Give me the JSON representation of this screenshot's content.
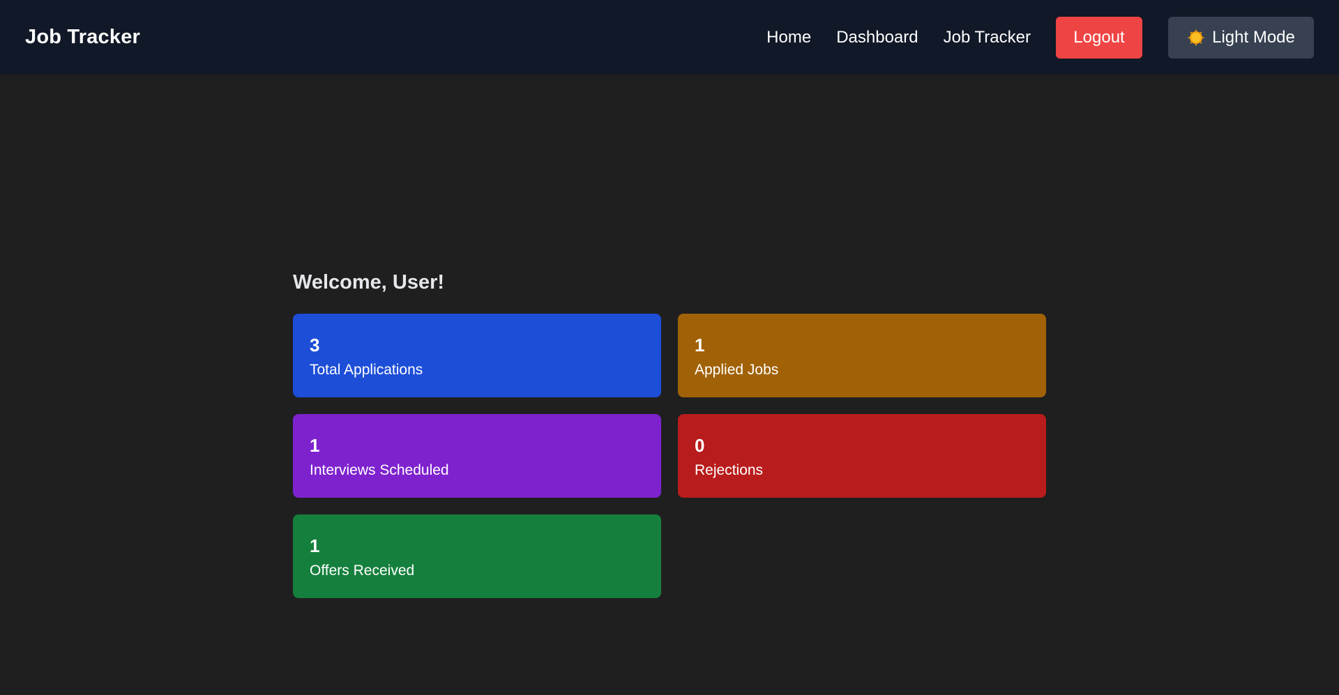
{
  "header": {
    "brand": "Job Tracker",
    "nav": [
      "Home",
      "Dashboard",
      "Job Tracker"
    ],
    "logout_label": "Logout",
    "mode_label": "Light Mode",
    "mode_icon": "sun-icon",
    "colors": {
      "background": "#111827",
      "logout": "#ef4444",
      "mode_button": "#374151"
    }
  },
  "main": {
    "welcome": "Welcome, User!",
    "stats": [
      {
        "value": "3",
        "label": "Total Applications",
        "color": "#1d4ed8"
      },
      {
        "value": "1",
        "label": "Applied Jobs",
        "color": "#a16207"
      },
      {
        "value": "1",
        "label": "Interviews Scheduled",
        "color": "#7e22ce"
      },
      {
        "value": "0",
        "label": "Rejections",
        "color": "#b91c1c"
      },
      {
        "value": "1",
        "label": "Offers Received",
        "color": "#15803d"
      }
    ]
  },
  "colors": {
    "page_background": "#1f1f1f"
  }
}
